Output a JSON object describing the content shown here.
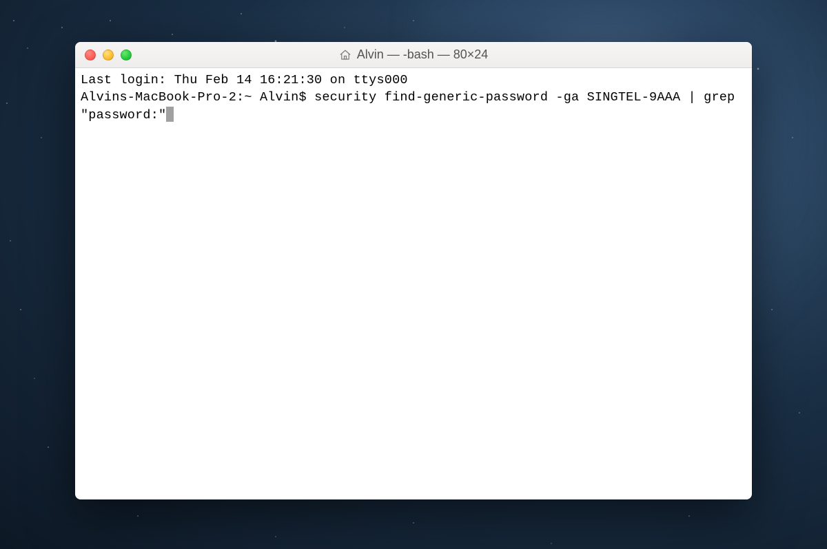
{
  "window": {
    "title": "Alvin — -bash — 80×24",
    "icon_name": "home-icon"
  },
  "terminal": {
    "last_login": "Last login: Thu Feb 14 16:21:30 on ttys000",
    "prompt": "Alvins-MacBook-Pro-2:~ Alvin$ ",
    "command": "security find-generic-password -ga SINGTEL-9AAA | grep \"password:\""
  },
  "colors": {
    "close": "#ff5f56",
    "minimize": "#ffbd2e",
    "zoom": "#27c93f"
  }
}
